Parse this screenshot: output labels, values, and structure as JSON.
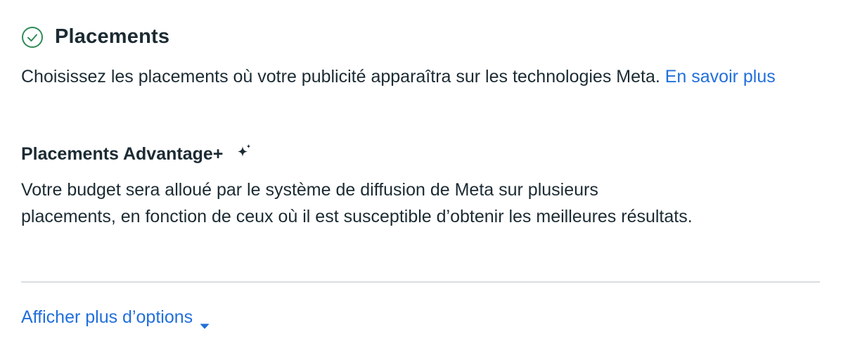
{
  "section": {
    "title": "Placements",
    "description": "Choisissez les placements où votre publicité apparaîtra sur les technologies Meta.",
    "learn_more_link": "En savoir plus",
    "status_icon": "check-circle-icon"
  },
  "advantage": {
    "title": "Placements Advantage+",
    "icon": "sparkle-icon",
    "body": "Votre budget sera alloué par le système de diffusion de Meta sur plusieurs placements, en fonction de ceux où il est susceptible d’obtenir les meilleures résultats."
  },
  "more_options": {
    "label": "Afficher plus d’options",
    "icon": "caret-down-icon"
  },
  "colors": {
    "text": "#1c2b33",
    "link": "#216fdb",
    "success": "#2e8b57",
    "divider": "#dadde1"
  }
}
